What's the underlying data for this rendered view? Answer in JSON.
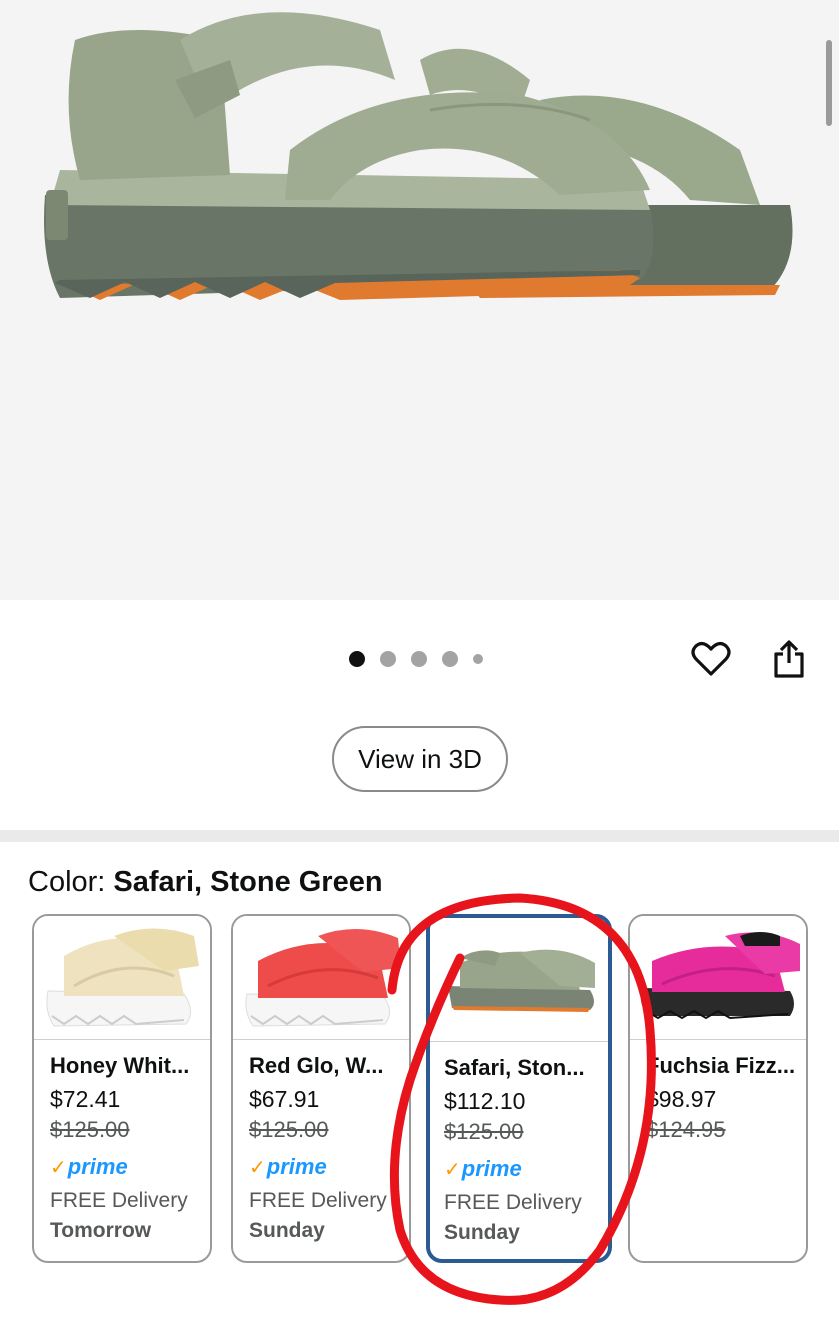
{
  "gallery": {
    "image_alt": "Green puffy sandal with orange sole",
    "dots_count": 5,
    "active_dot": 0
  },
  "actions": {
    "heart_icon": "heart-icon",
    "share_icon": "share-icon",
    "view_3d_label": "View in 3D"
  },
  "color": {
    "label": "Color: ",
    "value": "Safari, Stone Green"
  },
  "swatches": [
    {
      "name": "Honey Whit...",
      "price": "$72.41",
      "list_price": "$125.00",
      "prime": "prime",
      "delivery": "FREE Delivery",
      "delivery_day": "Tomorrow",
      "color": "#efe3bf",
      "selected": false
    },
    {
      "name": "Red Glo, W...",
      "price": "$67.91",
      "list_price": "$125.00",
      "prime": "prime",
      "delivery": "FREE Delivery",
      "delivery_day": "Sunday",
      "color": "#ee4b4b",
      "selected": false
    },
    {
      "name": "Safari, Ston...",
      "price": "$112.10",
      "list_price": "$125.00",
      "prime": "prime",
      "delivery": "FREE Delivery",
      "delivery_day": "Sunday",
      "color": "#8f9c85",
      "selected": true
    },
    {
      "name": "Fuchsia Fizz...",
      "price": "$98.97",
      "list_price": "$124.95",
      "prime": "",
      "delivery": "",
      "delivery_day": "",
      "color": "#e62c9b",
      "selected": false
    }
  ],
  "colors": {
    "selected_border": "#2c5a92",
    "prime_blue": "#1a98ff",
    "prime_check": "#ff9900",
    "annotation_red": "#e8141b"
  }
}
